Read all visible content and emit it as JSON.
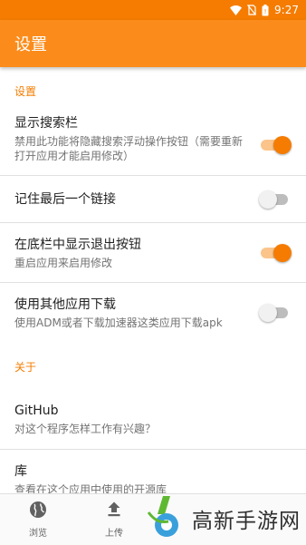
{
  "status_bar": {
    "time": "9:27",
    "icons": [
      "wifi-icon",
      "no-sim-icon",
      "battery-icon"
    ]
  },
  "app_bar": {
    "title": "设置"
  },
  "sections": {
    "settings": {
      "header": "设置"
    },
    "about": {
      "header": "关于"
    }
  },
  "preferences": [
    {
      "title": "显示搜索栏",
      "summary": "禁用此功能将隐藏搜索浮动操作按钮（需要重新打开应用才能启用修改）",
      "toggle": true
    },
    {
      "title": "记住最后一个链接",
      "toggle": false
    },
    {
      "title": "在底栏中显示退出按钮",
      "summary": "重启应用来启用修改",
      "toggle": true
    },
    {
      "title": "使用其他应用下载",
      "summary": "使用ADM或者下载加速器这类应用下载apk",
      "toggle": false
    }
  ],
  "about_items": [
    {
      "title": "GitHub",
      "summary": "对这个程序怎样工作有兴趣？"
    },
    {
      "title": "库",
      "summary": "查看在这个应用中使用的开源库"
    }
  ],
  "bottom_nav": {
    "items": [
      {
        "label": "浏览",
        "icon": "globe-icon"
      },
      {
        "label": "上传",
        "icon": "upload-icon"
      }
    ]
  },
  "watermark": {
    "text": "高新手游网",
    "icon": "logo-icon"
  },
  "colors": {
    "primary": "#fb8c1b",
    "primary_dark": "#f57c00",
    "toggle_on_track": "#fbc48b",
    "toggle_off_track": "#bdbdbd"
  }
}
